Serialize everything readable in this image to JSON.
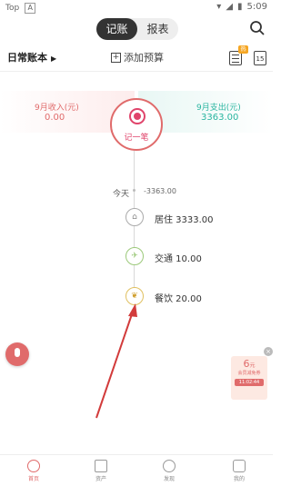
{
  "status_bar": {
    "carrier": "Top",
    "badge": "A",
    "time": "5:09"
  },
  "tabs": [
    {
      "label": "记账"
    },
    {
      "label": "报表"
    }
  ],
  "toolbar": {
    "book_name": "日常账本",
    "add_budget": "添加预算",
    "hot_badge": "热",
    "calendar_day": "15"
  },
  "summary": {
    "income_label": "9月收入(元)",
    "income_value": "0.00",
    "expense_label": "9月支出(元)",
    "expense_value": "3363.00",
    "record_button": "记一笔"
  },
  "timeline": {
    "today_label": "今天",
    "today_amount": "-3363.00",
    "items": [
      {
        "label": "居住 3333.00",
        "icon": "home-icon"
      },
      {
        "label": "交通 10.00",
        "icon": "plane-icon"
      },
      {
        "label": "餐饮 20.00",
        "icon": "food-icon"
      }
    ]
  },
  "promo": {
    "amount": "6",
    "unit": "元",
    "text": "会员减免券",
    "time": "11:02:44"
  },
  "bottom_nav": [
    {
      "label": "首页"
    },
    {
      "label": "资产"
    },
    {
      "label": "发现"
    },
    {
      "label": "我的"
    }
  ],
  "colors": {
    "accent": "#e06b6b",
    "income": "#e06b6b",
    "expense": "#2ab5a0"
  }
}
